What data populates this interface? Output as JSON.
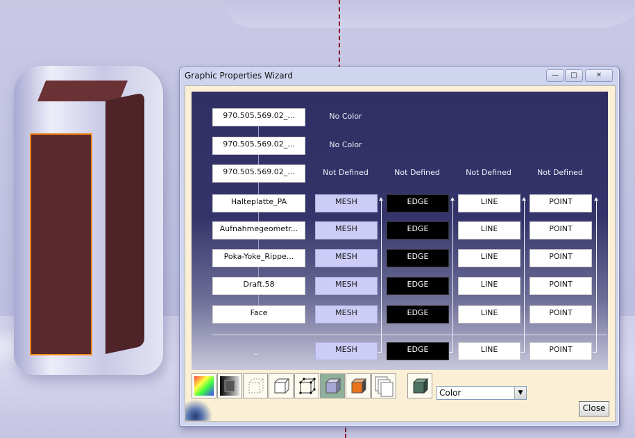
{
  "window": {
    "title": "Graphic Properties Wizard",
    "minimize_glyph": "—",
    "maximize_glyph": "□",
    "close_glyph": "✕"
  },
  "tree_nodes": [
    "970.505.569.02_...",
    "970.505.569.02_...",
    "970.505.569.02_...",
    "Halteplatte_PA",
    "Aufnahmegeometr...",
    "Poka-Yoke_Rippe...",
    "Draft.58",
    "Face"
  ],
  "status_labels": {
    "row1": "No Color",
    "row2": "No Color",
    "row3": [
      "Not Defined",
      "Not Defined",
      "Not Defined",
      "Not Defined"
    ]
  },
  "columns": {
    "mesh": "MESH",
    "edge": "EDGE",
    "line": "LINE",
    "point": "POINT"
  },
  "bottom_row_label": "_",
  "toolbar": {
    "tools": [
      "color-wheel-icon",
      "shading-icon",
      "wireframe-box-icon",
      "box-icon",
      "vertex-box-icon",
      "shaded-box-icon",
      "orange-face-box-icon",
      "layers-icon",
      "green-box-icon"
    ],
    "active_index": 5,
    "combo_value": "Color",
    "close_label": "Close"
  },
  "colors": {
    "mesh": "#ccccf6",
    "edge": "#000000",
    "panel_top": "#2f2f64",
    "client_bg": "#fbf0d6"
  }
}
